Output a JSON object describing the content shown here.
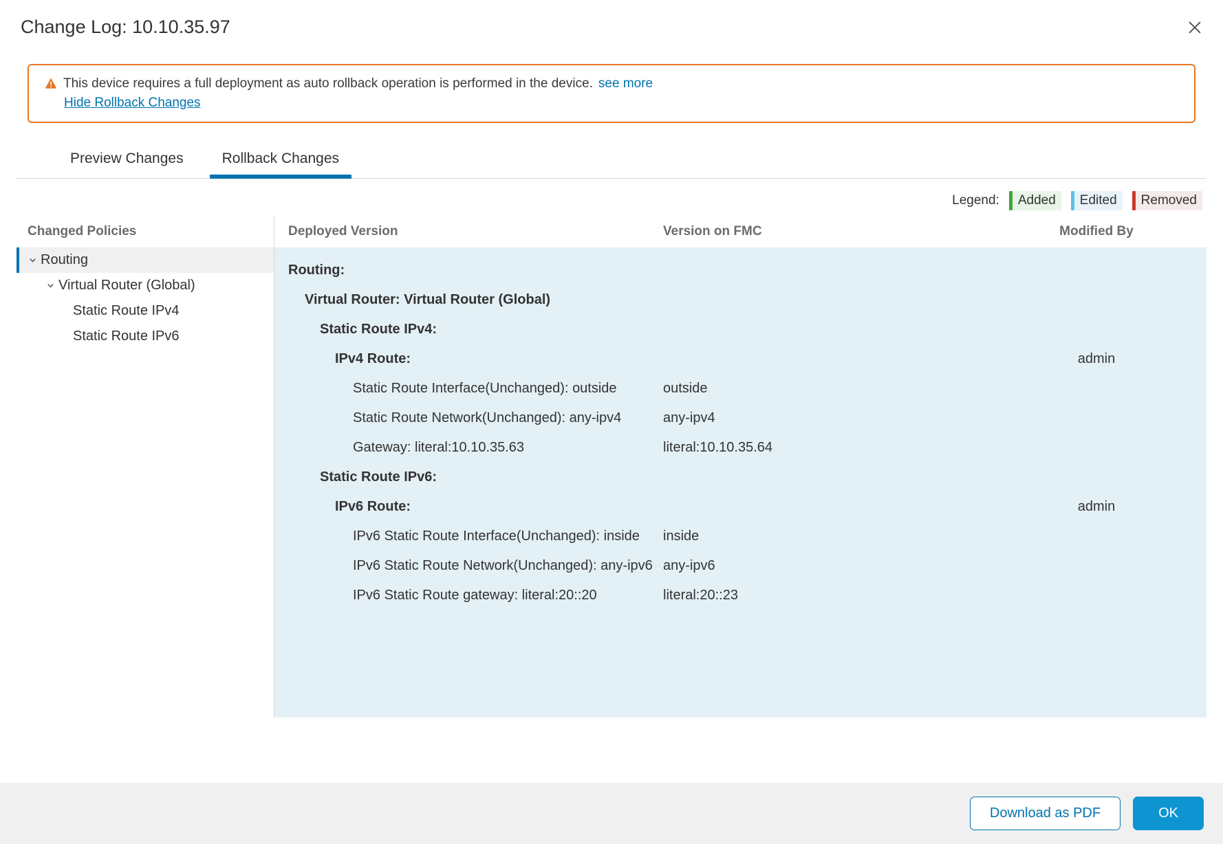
{
  "dialog": {
    "title": "Change Log: 10.10.35.97"
  },
  "alert": {
    "message": "This device requires a full deployment as auto rollback operation is performed in the device.",
    "see_more": "see more",
    "hide_link": "Hide Rollback Changes"
  },
  "tabs": {
    "preview": {
      "label": "Preview Changes",
      "active": false
    },
    "rollback": {
      "label": "Rollback Changes",
      "active": true
    }
  },
  "legend": {
    "label": "Legend:",
    "added": "Added",
    "edited": "Edited",
    "removed": "Removed"
  },
  "sidebar": {
    "heading": "Changed Policies",
    "items": [
      {
        "label": "Routing",
        "depth": 0,
        "expanded": true,
        "selected": true
      },
      {
        "label": "Virtual Router (Global)",
        "depth": 1,
        "expanded": true,
        "selected": false
      },
      {
        "label": "Static Route IPv4",
        "depth": 2,
        "expanded": false,
        "selected": false
      },
      {
        "label": "Static Route IPv6",
        "depth": 2,
        "expanded": false,
        "selected": false
      }
    ]
  },
  "columns": {
    "deployed": "Deployed Version",
    "fmc": "Version on FMC",
    "modified_by": "Modified By"
  },
  "diff": {
    "routing_label": "Routing:",
    "virtual_router_label": "Virtual Router: Virtual Router (Global)",
    "ipv4_section_label": "Static Route IPv4:",
    "ipv4_route_label": "IPv4 Route:",
    "ipv4_modified_by": "admin",
    "ipv4_rows": [
      {
        "deployed": "Static Route Interface(Unchanged): outside",
        "fmc": "outside"
      },
      {
        "deployed": "Static Route Network(Unchanged): any-ipv4",
        "fmc": "any-ipv4"
      },
      {
        "deployed": "Gateway: literal:10.10.35.63",
        "fmc": "literal:10.10.35.64"
      }
    ],
    "ipv6_section_label": "Static Route IPv6:",
    "ipv6_route_label": "IPv6 Route:",
    "ipv6_modified_by": "admin",
    "ipv6_rows": [
      {
        "deployed": "IPv6 Static Route Interface(Unchanged): inside",
        "fmc": "inside"
      },
      {
        "deployed": "IPv6 Static Route Network(Unchanged): any-ipv6",
        "fmc": "any-ipv6"
      },
      {
        "deployed": "IPv6 Static Route gateway: literal:20::20",
        "fmc": "literal:20::23"
      }
    ]
  },
  "footer": {
    "download": "Download as PDF",
    "ok": "OK"
  }
}
